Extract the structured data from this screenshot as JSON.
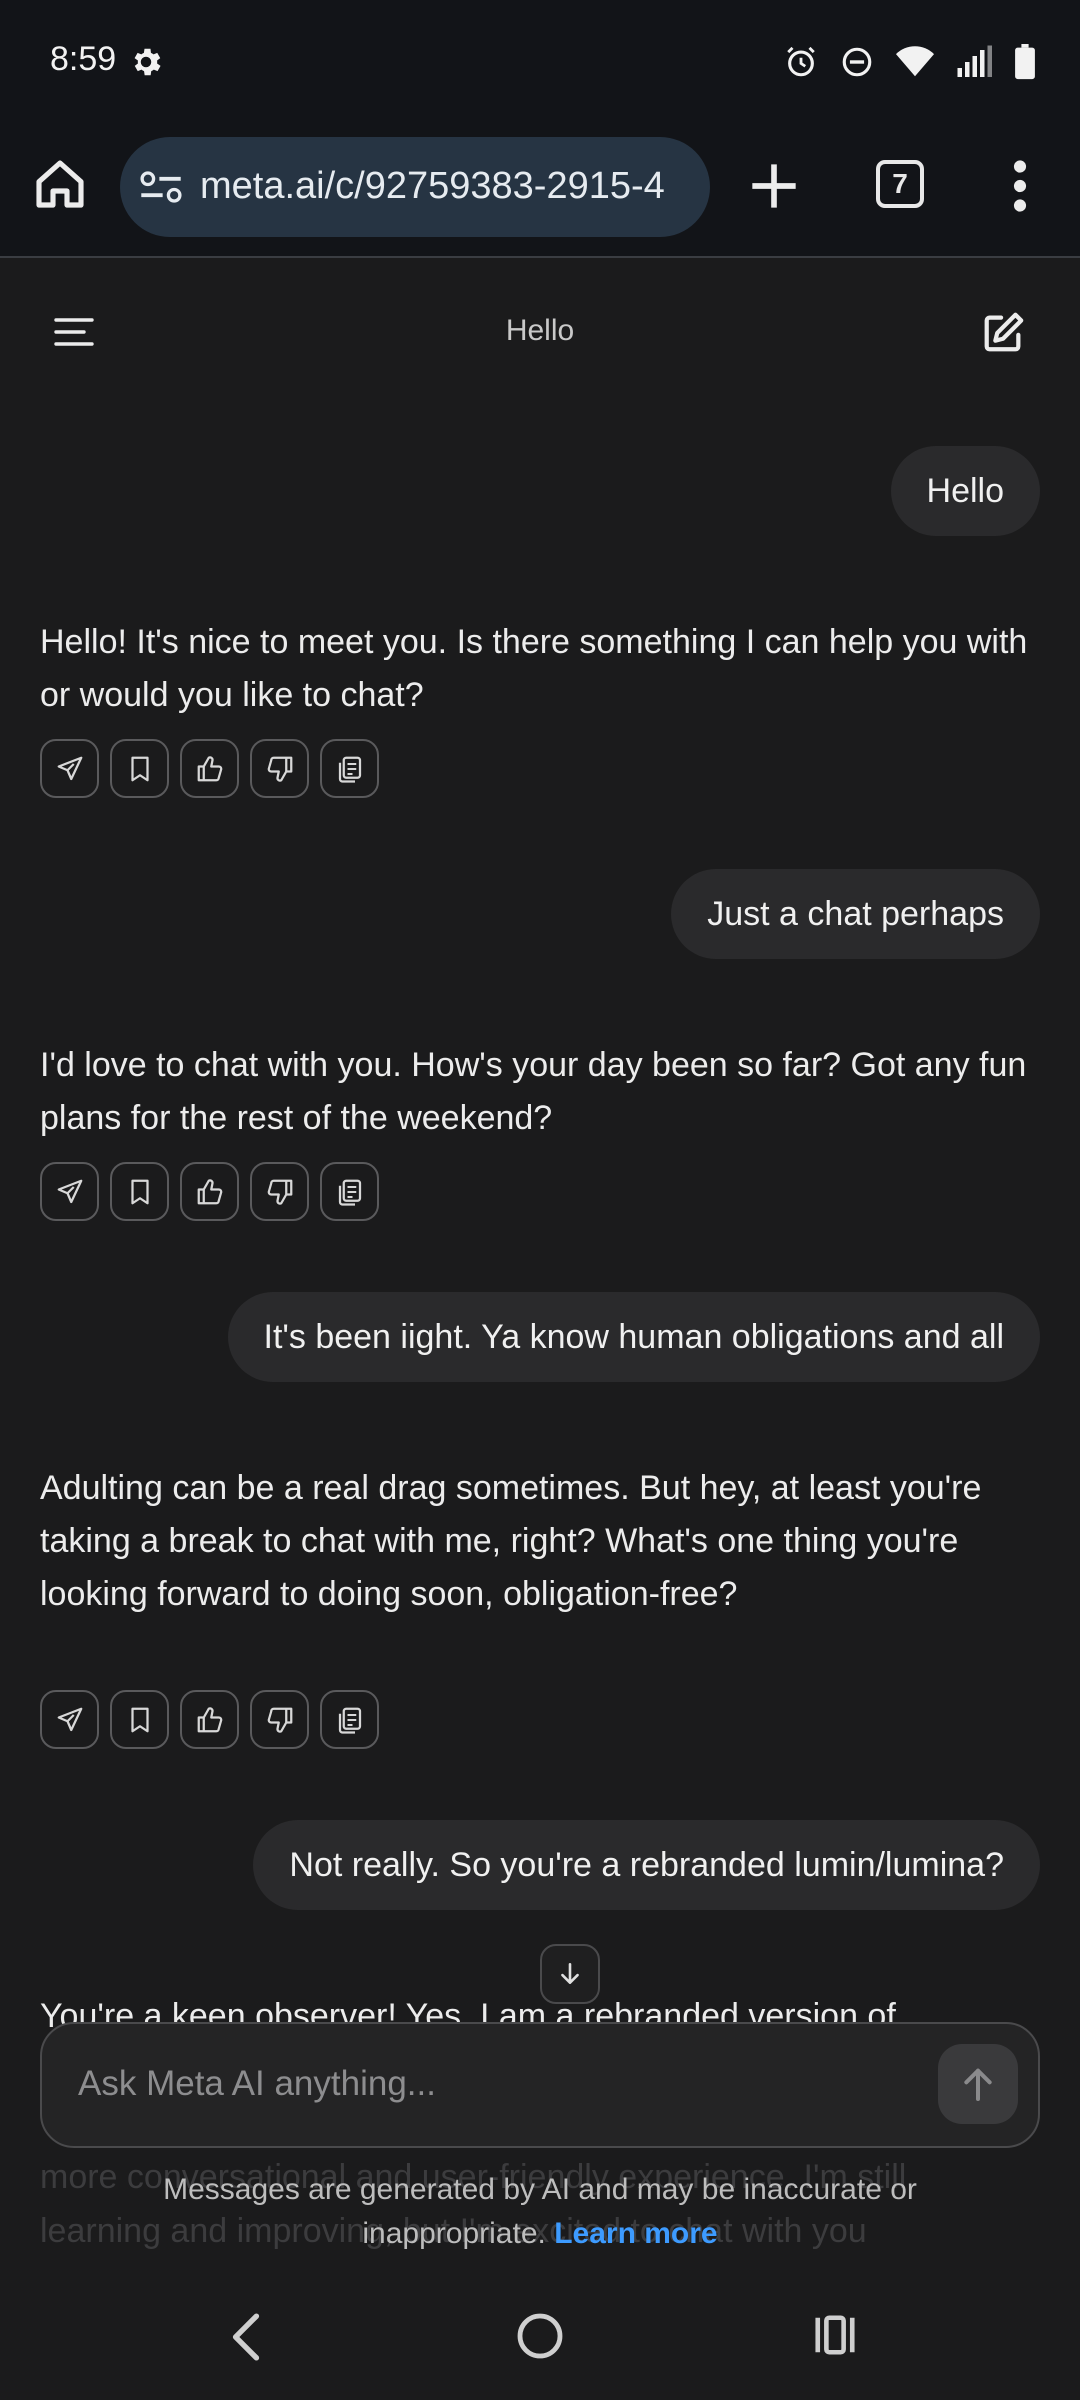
{
  "status_bar": {
    "time": "8:59"
  },
  "browser": {
    "url": "meta.ai/c/92759383-2915-4",
    "tab_count": "7"
  },
  "app": {
    "title": "Hello"
  },
  "conversation": {
    "user_1": "Hello",
    "ai_1": "Hello! It's nice to meet you. Is there something I can help you with or would you like to chat?",
    "user_2": "Just a chat perhaps",
    "ai_2": "I'd love to chat with you. How's your day been so far? Got any fun plans for the rest of the weekend?",
    "user_3": "It's been iight. Ya know human obligations and all",
    "ai_3": "Adulting can be a real drag sometimes. But hey, at least you're taking a break to chat with me, right? What's one thing you're looking forward to doing soon, obligation-free?",
    "user_4": "Not really. So you're a rebranded lumin/lumina?",
    "ai_4_partial": "You're a keen observer! Yes, I am a rebranded version of",
    "ai_4_faded_1": "more conversational and user-friendly experience. I'm still",
    "ai_4_faded_2": "learning and improving, but I'm excited to chat with you"
  },
  "composer": {
    "placeholder": "Ask Meta AI anything..."
  },
  "disclaimer": {
    "line1": "Messages are generated by AI and may be inaccurate or",
    "line2": "inappropriate.",
    "link": "Learn more"
  },
  "colors": {
    "link": "#3d9bff",
    "url_bar": "#263443",
    "bubble": "#2a2a2c",
    "background": "#1b1b1c"
  },
  "icons": [
    "gear-icon",
    "alarm-icon",
    "dnd-icon",
    "wifi-icon",
    "signal-icon",
    "battery-icon",
    "home-icon",
    "site-settings-icon",
    "plus-icon",
    "more-vert-icon",
    "hamburger-icon",
    "new-chat-icon",
    "share-icon",
    "bookmark-icon",
    "thumbs-up-icon",
    "thumbs-down-icon",
    "copy-icon",
    "arrow-down-icon",
    "send-arrow-icon",
    "nav-back-icon",
    "nav-home-icon",
    "nav-recents-icon"
  ]
}
